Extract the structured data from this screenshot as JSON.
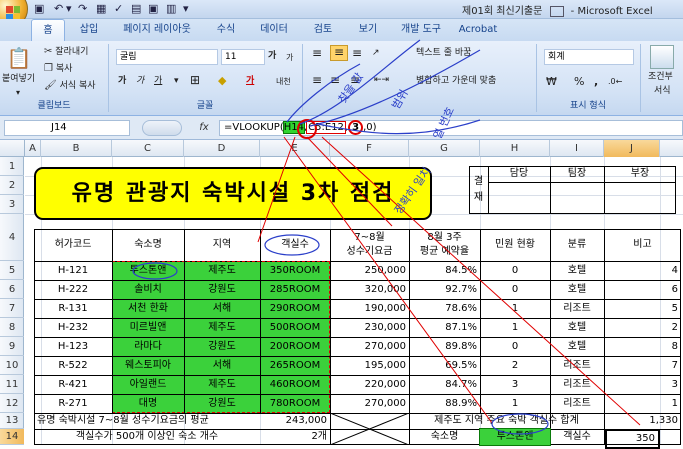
{
  "window": {
    "title": "제01회 최신기출문",
    "app": "Microsoft Excel"
  },
  "tabs": [
    "홈",
    "삽입",
    "페이지 레이아웃",
    "수식",
    "데이터",
    "검토",
    "보기",
    "개발 도구",
    "Acrobat"
  ],
  "ribbon": {
    "clipboard": {
      "paste": "붙여넣기",
      "cut": "잘라내기",
      "copy": "복사",
      "format_painter": "서식 복사",
      "label": "클립보드"
    },
    "font": {
      "name": "굴림",
      "size": "11",
      "label": "글꼴",
      "bold": "가",
      "italic": "가",
      "underline": "가",
      "grow": "가",
      "shrink": "가"
    },
    "alignment": {
      "wrap": "텍스트 줄 바꿈",
      "merge": "병합하고 가운데 맞춤"
    },
    "number": {
      "format": "회계",
      "label": "표시 형식",
      "currency": "₩",
      "percent": "%",
      "comma": ","
    },
    "styles": {
      "conditional": "조건부",
      "format": "서식"
    }
  },
  "formula_bar": {
    "name_box": "J14",
    "fx": "fx",
    "prefix": "=VLOOKUP(",
    "arg1": "H14",
    "sep1": ",",
    "arg2": "C5:E12",
    "sep2": ",",
    "arg3": "3",
    "suffix": ",0)"
  },
  "columns": [
    "A",
    "B",
    "C",
    "D",
    "E",
    "F",
    "G",
    "H",
    "I",
    "J"
  ],
  "rows": [
    "1",
    "2",
    "3",
    "4",
    "5",
    "6",
    "7",
    "8",
    "9",
    "10",
    "11",
    "12",
    "13",
    "14"
  ],
  "sheet": {
    "title": "유명 관광지 숙박시설 3차 점검",
    "approval": {
      "label1": "결",
      "label2": "재",
      "h1": "담당",
      "h2": "팀장",
      "h3": "부장"
    },
    "headers": {
      "code": "허가코드",
      "name": "숙소명",
      "region": "지역",
      "rooms": "객실수",
      "fee1": "7~8월",
      "fee2": "성수기요금",
      "rate1": "8월 3주",
      "rate2": "평균 예약율",
      "complaint": "민원 현황",
      "category": "분류",
      "note": "비고"
    },
    "data": [
      [
        "H-121",
        "투스톤앤",
        "제주도",
        "350ROOM",
        "250,000",
        "84.5%",
        "0",
        "호텔",
        "4"
      ],
      [
        "H-222",
        "솔비치",
        "강원도",
        "285ROOM",
        "320,000",
        "92.7%",
        "0",
        "호텔",
        "6"
      ],
      [
        "R-131",
        "서천 한화",
        "서해",
        "290ROOM",
        "190,000",
        "78.6%",
        "1",
        "리조트",
        "5"
      ],
      [
        "H-232",
        "미르빌앤",
        "제주도",
        "500ROOM",
        "230,000",
        "87.1%",
        "1",
        "호텔",
        "2"
      ],
      [
        "H-123",
        "라마다",
        "강원도",
        "200ROOM",
        "270,000",
        "89.8%",
        "0",
        "호텔",
        "8"
      ],
      [
        "R-522",
        "웨스토피아",
        "서해",
        "265ROOM",
        "195,000",
        "69.5%",
        "2",
        "리조트",
        "7"
      ],
      [
        "R-421",
        "아일랜드",
        "제주도",
        "460ROOM",
        "220,000",
        "84.7%",
        "3",
        "리조트",
        "3"
      ],
      [
        "R-271",
        "대명",
        "강원도",
        "780ROOM",
        "270,000",
        "88.9%",
        "1",
        "리조트",
        "1"
      ]
    ],
    "row13": {
      "label": "유명 숙박시설 7~8월 성수기요금의 평균",
      "value": "243,000",
      "label2": "제주도 지역 주요 숙박 객실수 합계",
      "value2": "1,330"
    },
    "row14": {
      "label": "객실수가 500개 이상인 숙소 개수",
      "value": "2개",
      "h_label": "숙소명",
      "h_value": "투스톤앤",
      "i_label": "객실수",
      "j_value": "350"
    }
  },
  "annotations": [
    "찾을 값",
    "범위",
    "열 번호",
    "정확히 일치"
  ],
  "colors": {
    "highlight": "#3bd13b",
    "title_fill": "#ffff00",
    "ink": "#2b3fc9",
    "red": "#e00000"
  }
}
